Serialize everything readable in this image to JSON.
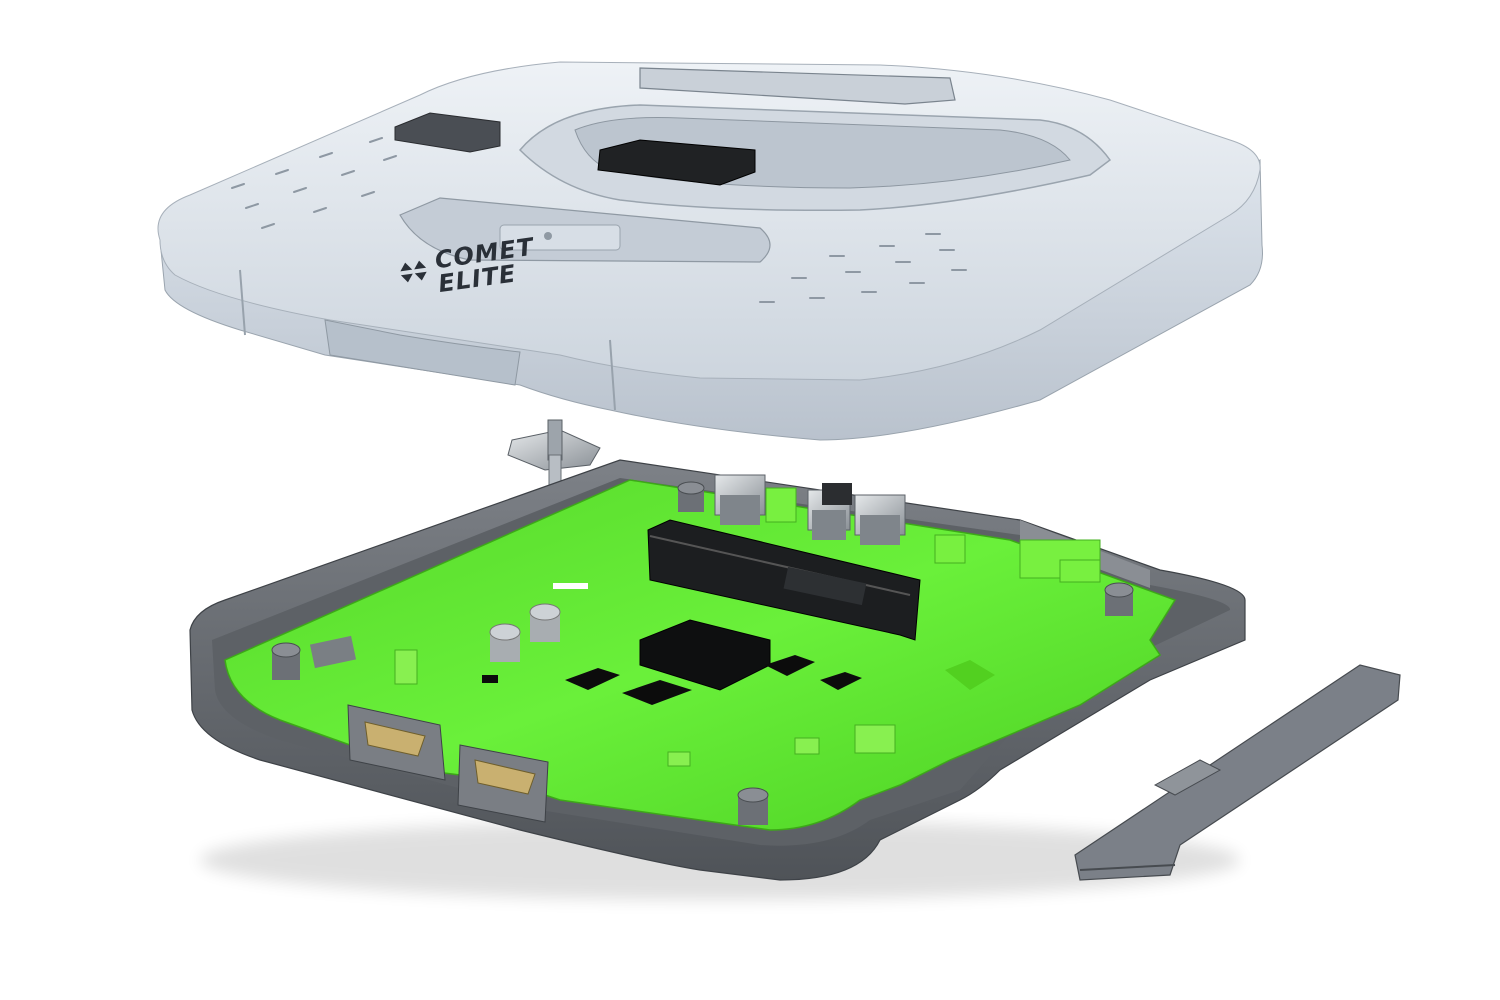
{
  "scene": {
    "subject": "exploded-console-enclosure-render",
    "background_color": "#ffffff",
    "top_shell_color": "#d9e0e8",
    "bottom_shell_color": "#6b6f75",
    "pcb_color": "#5ee62e",
    "chip_color": "#101010",
    "connector_metal_color": "#c9b070"
  },
  "logo": {
    "line1": "COMET",
    "line2": "ELITE"
  },
  "icons": {
    "logo_mark": "four-arrows-logo-icon"
  }
}
